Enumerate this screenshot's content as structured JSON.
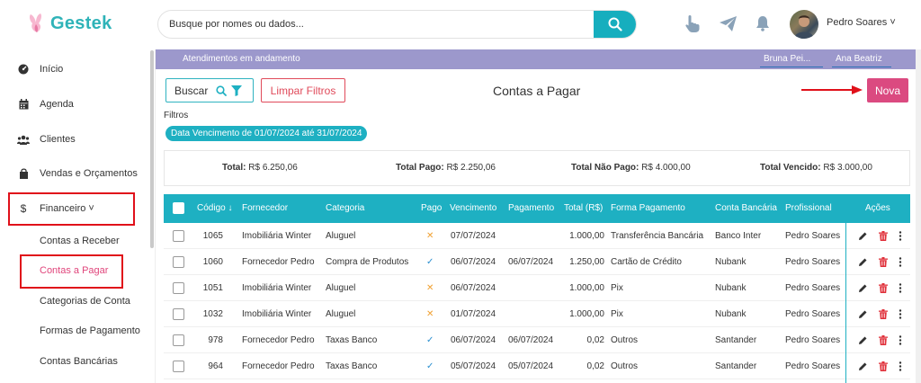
{
  "brand": {
    "name": "Gestek"
  },
  "search": {
    "placeholder": "Busque por nomes ou dados..."
  },
  "user": {
    "name": "Pedro Soares ˅"
  },
  "sidebar": {
    "items": [
      {
        "label": "Início",
        "icon": "dashboard-icon"
      },
      {
        "label": "Agenda",
        "icon": "calendar-icon"
      },
      {
        "label": "Clientes",
        "icon": "users-icon"
      },
      {
        "label": "Vendas e Orçamentos",
        "icon": "shopping-bag-icon"
      },
      {
        "label": "Financeiro ˅",
        "icon": "dollar-icon"
      }
    ],
    "sub_items": [
      {
        "label": "Contas a Receber",
        "active": false
      },
      {
        "label": "Contas a Pagar",
        "active": true
      },
      {
        "label": "Categorias de Conta",
        "active": false
      },
      {
        "label": "Formas de Pagamento",
        "active": false
      },
      {
        "label": "Contas Bancárias",
        "active": false
      }
    ]
  },
  "banner": {
    "text": "Atendimentos em andamento",
    "tags": [
      "Bruna Pei...",
      "Ana Beatriz"
    ]
  },
  "toolbar": {
    "buscar_label": "Buscar",
    "limpar_label": "Limpar Filtros",
    "title": "Contas a Pagar",
    "nova_label": "Nova"
  },
  "filters": {
    "label": "Filtros",
    "chip": "Data Vencimento de 01/07/2024 até 31/07/2024"
  },
  "totals": {
    "total_label": "Total:",
    "total_value": "R$ 6.250,06",
    "pago_label": "Total Pago:",
    "pago_value": "R$ 2.250,06",
    "nao_pago_label": "Total Não Pago:",
    "nao_pago_value": "R$ 4.000,00",
    "vencido_label": "Total Vencido:",
    "vencido_value": "R$ 3.000,00"
  },
  "table": {
    "headers": {
      "codigo": "Código ↓",
      "fornecedor": "Fornecedor",
      "categoria": "Categoria",
      "pago": "Pago",
      "vencimento": "Vencimento",
      "pagamento": "Pagamento",
      "total": "Total (R$)",
      "forma": "Forma Pagamento",
      "conta": "Conta Bancária",
      "profissional": "Profissional",
      "acoes": "Ações"
    },
    "rows": [
      {
        "codigo": "1065",
        "fornecedor": "Imobiliária Winter",
        "categoria": "Aluguel",
        "pago": "✕",
        "vencimento": "07/07/2024",
        "pagamento": "",
        "total": "1.000,00",
        "forma": "Transferência Bancária",
        "conta": "Banco Inter",
        "profissional": "Pedro Soares"
      },
      {
        "codigo": "1060",
        "fornecedor": "Fornecedor Pedro",
        "categoria": "Compra de Produtos",
        "pago": "✓",
        "vencimento": "06/07/2024",
        "pagamento": "06/07/2024",
        "total": "1.250,00",
        "forma": "Cartão de Crédito",
        "conta": "Nubank",
        "profissional": "Pedro Soares"
      },
      {
        "codigo": "1051",
        "fornecedor": "Imobiliária Winter",
        "categoria": "Aluguel",
        "pago": "✕",
        "vencimento": "06/07/2024",
        "pagamento": "",
        "total": "1.000,00",
        "forma": "Pix",
        "conta": "Nubank",
        "profissional": "Pedro Soares"
      },
      {
        "codigo": "1032",
        "fornecedor": "Imobiliária Winter",
        "categoria": "Aluguel",
        "pago": "✕",
        "vencimento": "01/07/2024",
        "pagamento": "",
        "total": "1.000,00",
        "forma": "Pix",
        "conta": "Nubank",
        "profissional": "Pedro Soares"
      },
      {
        "codigo": "978",
        "fornecedor": "Fornecedor Pedro",
        "categoria": "Taxas Banco",
        "pago": "✓",
        "vencimento": "06/07/2024",
        "pagamento": "06/07/2024",
        "total": "0,02",
        "forma": "Outros",
        "conta": "Santander",
        "profissional": "Pedro Soares"
      },
      {
        "codigo": "964",
        "fornecedor": "Fornecedor Pedro",
        "categoria": "Taxas Banco",
        "pago": "✓",
        "vencimento": "05/07/2024",
        "pagamento": "05/07/2024",
        "total": "0,02",
        "forma": "Outros",
        "conta": "Santander",
        "profissional": "Pedro Soares"
      }
    ]
  },
  "colors": {
    "accent": "#1eb0c2",
    "brand": "#2fb3b8",
    "nova": "#db4a80",
    "active_link": "#e0457b",
    "paid_check": "#2a8fd0",
    "unpaid_x": "#f0a030",
    "delete": "#e0303a",
    "banner": "#9c98cc"
  }
}
